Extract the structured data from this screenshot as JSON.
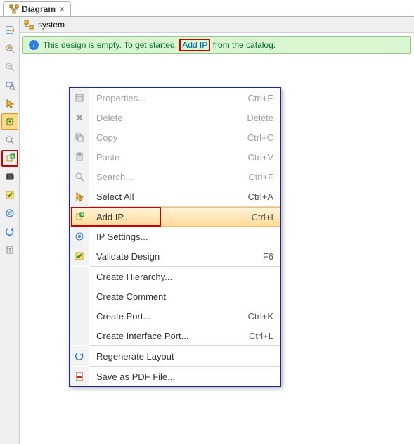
{
  "tab": {
    "title": "Diagram",
    "close": "×"
  },
  "header": {
    "design_label": "system"
  },
  "info": {
    "text_before": "This design is empty. To get started, ",
    "link": "Add IP",
    "text_after": " from the catalog."
  },
  "toolbar": {
    "items": [
      "collapse-panel",
      "zoom-in",
      "zoom-out",
      "zoom-fit",
      "select",
      "auto-layout",
      "search",
      "add-ip",
      "ip-packager",
      "validate",
      "settings",
      "regenerate",
      "toggle-view"
    ]
  },
  "context_menu": {
    "items": [
      {
        "label": "Properties...",
        "shortcut": "Ctrl+E",
        "disabled": true,
        "icon": "properties"
      },
      {
        "label": "Delete",
        "shortcut": "Delete",
        "disabled": true,
        "icon": "delete"
      },
      {
        "label": "Copy",
        "shortcut": "Ctrl+C",
        "disabled": true,
        "icon": "copy"
      },
      {
        "label": "Paste",
        "shortcut": "Ctrl+V",
        "disabled": true,
        "icon": "paste"
      },
      {
        "label": "Search...",
        "shortcut": "Ctrl+F",
        "disabled": true,
        "icon": "search"
      },
      {
        "label": "Select All",
        "shortcut": "Ctrl+A",
        "disabled": false,
        "icon": "select-all"
      },
      {
        "divider": true
      },
      {
        "label": "Add IP...",
        "shortcut": "Ctrl+I",
        "disabled": false,
        "icon": "add-ip",
        "selected": true
      },
      {
        "label": "IP Settings...",
        "shortcut": "",
        "disabled": false,
        "icon": "ip-settings"
      },
      {
        "label": "Validate Design",
        "shortcut": "F6",
        "disabled": false,
        "icon": "validate"
      },
      {
        "divider": true
      },
      {
        "label": "Create Hierarchy...",
        "shortcut": "",
        "disabled": false,
        "icon": ""
      },
      {
        "label": "Create Comment",
        "shortcut": "",
        "disabled": false,
        "icon": ""
      },
      {
        "label": "Create Port...",
        "shortcut": "Ctrl+K",
        "disabled": false,
        "icon": ""
      },
      {
        "label": "Create Interface Port...",
        "shortcut": "Ctrl+L",
        "disabled": false,
        "icon": ""
      },
      {
        "divider": true
      },
      {
        "label": "Regenerate Layout",
        "shortcut": "",
        "disabled": false,
        "icon": "regenerate"
      },
      {
        "divider": true
      },
      {
        "label": "Save as PDF File...",
        "shortcut": "",
        "disabled": false,
        "icon": "pdf"
      }
    ]
  }
}
